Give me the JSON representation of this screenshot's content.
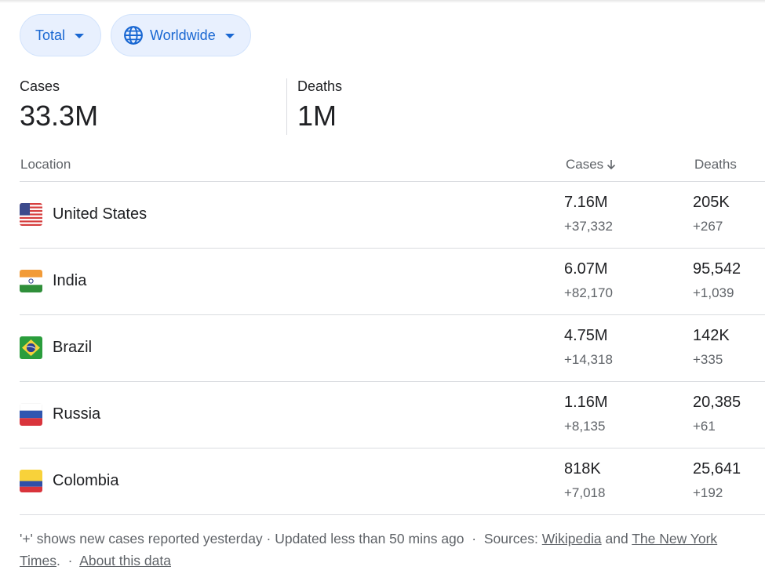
{
  "filters": {
    "metric": {
      "label": "Total",
      "icon": "caret-down-icon"
    },
    "region": {
      "label": "Worldwide",
      "icon": "globe-icon",
      "accent": "#1967d2"
    }
  },
  "summary": {
    "cases": {
      "label": "Cases",
      "value": "33.3M"
    },
    "deaths": {
      "label": "Deaths",
      "value": "1M"
    }
  },
  "table": {
    "headers": {
      "location": "Location",
      "cases": "Cases",
      "deaths": "Deaths",
      "sort_icon": "arrow-down-icon"
    },
    "rows": [
      {
        "location": "United States",
        "flag": "us-flag-icon",
        "cases": "7.16M",
        "cases_new": "+37,332",
        "deaths": "205K",
        "deaths_new": "+267"
      },
      {
        "location": "India",
        "flag": "india-flag-icon",
        "cases": "6.07M",
        "cases_new": "+82,170",
        "deaths": "95,542",
        "deaths_new": "+1,039"
      },
      {
        "location": "Brazil",
        "flag": "brazil-flag-icon",
        "cases": "4.75M",
        "cases_new": "+14,318",
        "deaths": "142K",
        "deaths_new": "+335"
      },
      {
        "location": "Russia",
        "flag": "russia-flag-icon",
        "cases": "1.16M",
        "cases_new": "+8,135",
        "deaths": "20,385",
        "deaths_new": "+61"
      },
      {
        "location": "Colombia",
        "flag": "colombia-flag-icon",
        "cases": "818K",
        "cases_new": "+7,018",
        "deaths": "25,641",
        "deaths_new": "+192"
      }
    ]
  },
  "footer": {
    "note": "'+' shows new cases reported yesterday",
    "sep": " · ",
    "updated": "Updated less than 50 mins ago",
    "sep2": "  ·  ",
    "sources_label": "Sources: ",
    "source1": "Wikipedia",
    "and": " and ",
    "source2": "The New York Times",
    "period": ".",
    "sep3": "  ·  ",
    "about": "About this data"
  }
}
